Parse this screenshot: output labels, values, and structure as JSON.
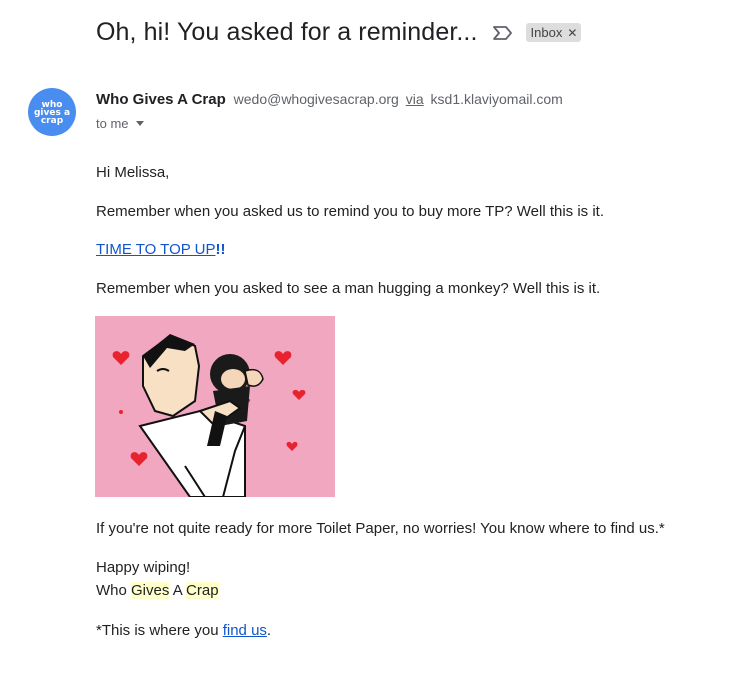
{
  "email": {
    "subject": "Oh, hi! You asked for a reminder...",
    "label": "Inbox",
    "sender": {
      "avatar_text": [
        "who",
        "gives a",
        "crap"
      ],
      "name": "Who Gives A Crap",
      "email": "wedo@whogivesacrap.org",
      "via_label": "via",
      "via_domain": "ksd1.klaviyomail.com",
      "to": "to me"
    },
    "body": {
      "greeting": "Hi Melissa,",
      "para1": "Remember when you asked us to remind you to buy more TP? Well this is it.",
      "cta_text": "TIME TO TOP UP",
      "cta_suffix": "!!",
      "para2": "Remember when you asked to see a man hugging a monkey? Well this is it.",
      "para3": "If you're not quite ready for more Toilet Paper, no worries! You know where to find us.*",
      "signoff": "Happy wiping!",
      "sig_parts": [
        "Who ",
        "Gives",
        " A ",
        "Crap"
      ],
      "footnote_prefix": "*This is where you ",
      "footnote_link": "find us",
      "footnote_suffix": "."
    },
    "colors": {
      "avatar_bg": "#4a8df0",
      "link": "#1155cc",
      "highlight": "#ffffcc",
      "gif_bg": "#f2a7c0"
    }
  }
}
